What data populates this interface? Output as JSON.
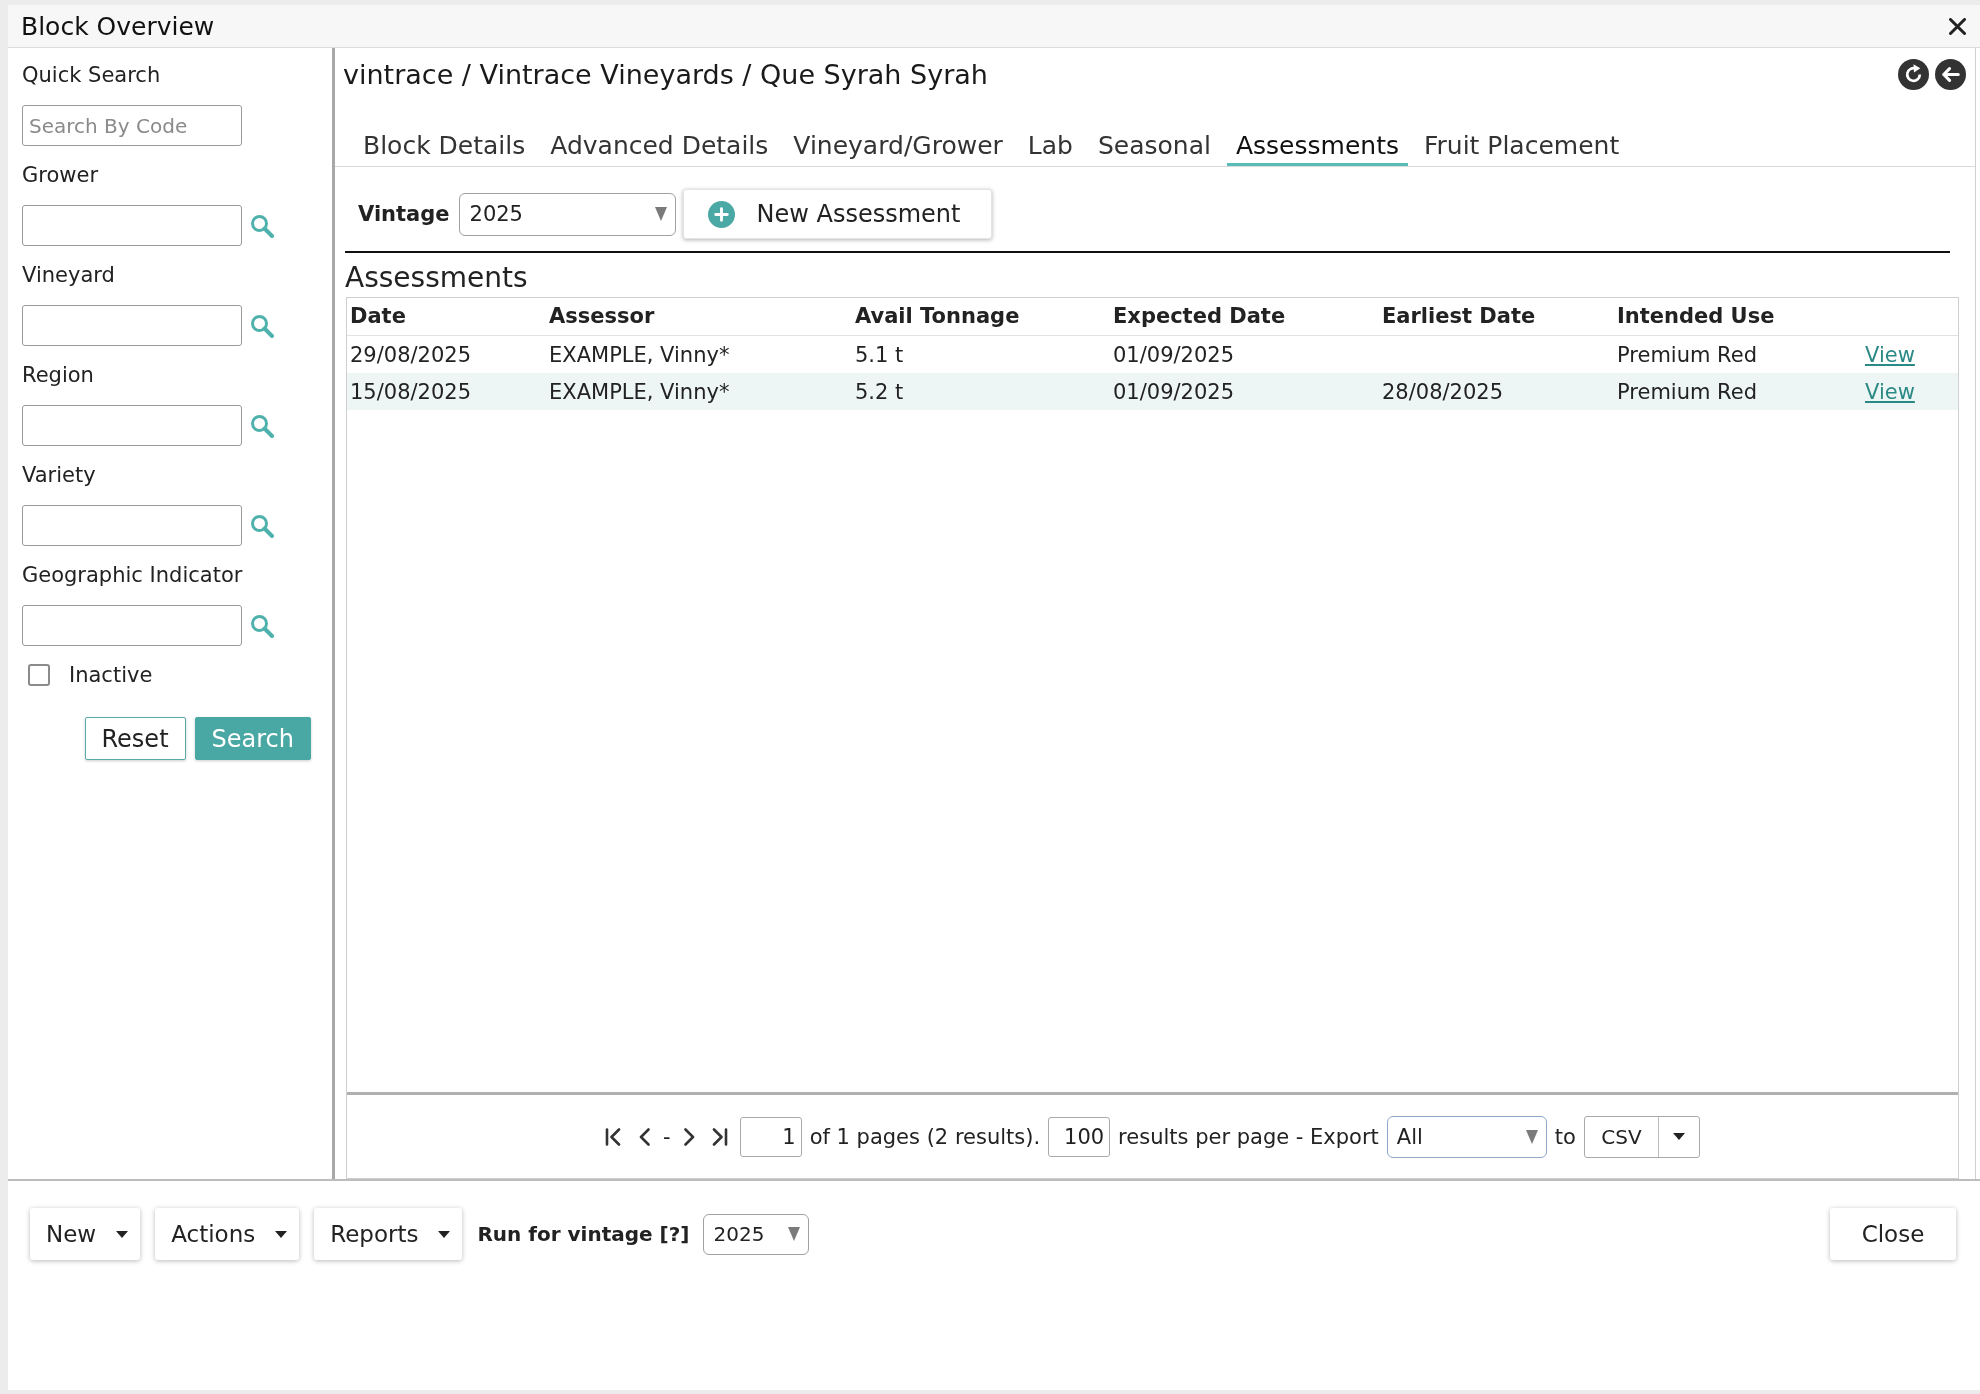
{
  "window": {
    "title": "Block Overview"
  },
  "sidebar": {
    "fields": [
      {
        "label": "Quick Search",
        "kind": "text",
        "placeholder": "Search By Code"
      },
      {
        "label": "Grower",
        "kind": "lookup"
      },
      {
        "label": "Vineyard",
        "kind": "lookup"
      },
      {
        "label": "Region",
        "kind": "lookup"
      },
      {
        "label": "Variety",
        "kind": "lookup"
      },
      {
        "label": "Geographic Indicator",
        "kind": "lookup"
      }
    ],
    "inactive": {
      "label": "Inactive",
      "checked": false
    },
    "buttons": [
      {
        "label": "Reset",
        "kind": "secondary"
      },
      {
        "label": "Search",
        "kind": "primary"
      }
    ]
  },
  "header": {
    "breadcrumb": "vintrace / Vintrace Vineyards / Que Syrah Syrah"
  },
  "tabs": [
    {
      "label": "Block Details",
      "selected": false
    },
    {
      "label": "Advanced Details",
      "selected": false
    },
    {
      "label": "Vineyard/Grower",
      "selected": false
    },
    {
      "label": "Lab",
      "selected": false
    },
    {
      "label": "Seasonal",
      "selected": false
    },
    {
      "label": "Assessments",
      "selected": true
    },
    {
      "label": "Fruit Placement",
      "selected": false
    }
  ],
  "assessments": {
    "vintage_label": "Vintage",
    "vintage": "2025",
    "new_button": "New Assessment",
    "title": "Assessments",
    "table": {
      "columns": [
        "Date",
        "Assessor",
        "Avail Tonnage",
        "Expected Date",
        "Earliest Date",
        "Intended Use"
      ],
      "rows": [
        {
          "date": "29/08/2025",
          "assessor": "EXAMPLE, Vinny*",
          "avail_tonnage": "5.1 t",
          "expected_date": "01/09/2025",
          "intended_use": "Premium Red",
          "action": "View"
        },
        {
          "date": "15/08/2025",
          "assessor": "EXAMPLE, Vinny*",
          "avail_tonnage": "5.2 t",
          "expected_date": "01/09/2025",
          "earliest_date": "28/08/2025",
          "intended_use": "Premium Red",
          "action": "View"
        }
      ]
    },
    "pager": {
      "separator": "-",
      "page": "1",
      "summary": "of 1 pages (2 results).",
      "per_page": "100",
      "per_page_label": "results per page - Export",
      "export_scope": "All",
      "to_label": "to",
      "format": "CSV"
    }
  },
  "footer": {
    "menus": [
      "New",
      "Actions",
      "Reports"
    ],
    "vintage_label": "Run for vintage [?]",
    "vintage": "2025",
    "close": "Close"
  }
}
